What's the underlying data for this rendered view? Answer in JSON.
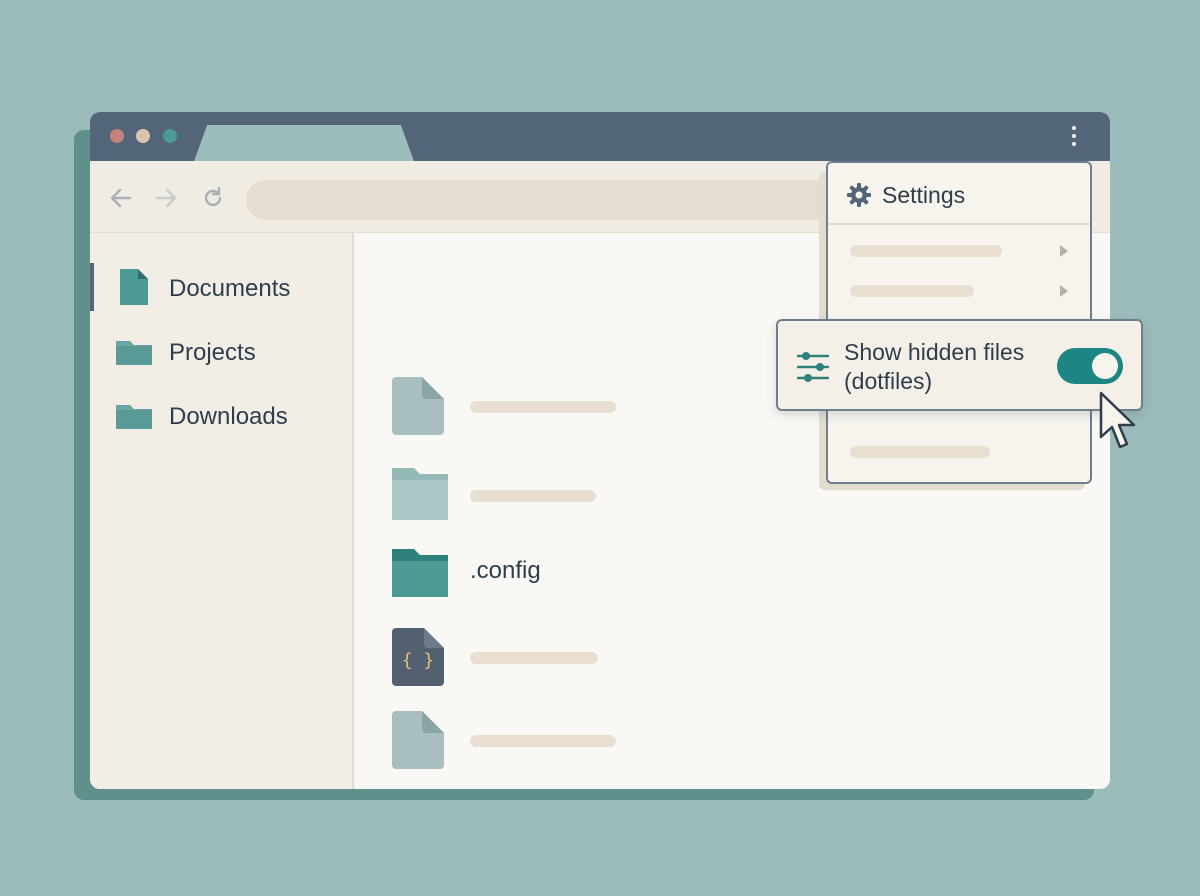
{
  "window": {
    "traffic_lights": [
      "#c7837a",
      "#d9c6ac",
      "#4b9a94"
    ]
  },
  "toolbar": {
    "back_icon": "arrow-left-icon",
    "forward_icon": "arrow-right-icon",
    "reload_icon": "reload-icon",
    "menu_icon": "more-vert-icon"
  },
  "sidebar": {
    "items": [
      {
        "label": "Documents",
        "icon": "document-icon",
        "active": true
      },
      {
        "label": "Projects",
        "icon": "folder-icon",
        "active": false
      },
      {
        "label": "Downloads",
        "icon": "folder-icon",
        "active": false
      }
    ]
  },
  "files": [
    {
      "icon": "document-icon",
      "label": ""
    },
    {
      "icon": "folder-icon",
      "label": ""
    },
    {
      "icon": "folder-icon",
      "label": ".config"
    },
    {
      "icon": "json-file-icon",
      "label": ""
    },
    {
      "icon": "document-icon",
      "label": ""
    },
    {
      "icon": "folder-icon",
      "label": ""
    }
  ],
  "settings_menu": {
    "title": "Settings",
    "icon": "gear-icon",
    "toggle": {
      "label_line1": "Show hidden files",
      "label_line2": "(dotfiles)",
      "icon": "sliders-icon",
      "enabled": true
    }
  },
  "colors": {
    "accent": "#1d8584",
    "titlebar": "#536679",
    "background": "#9bbcba"
  }
}
